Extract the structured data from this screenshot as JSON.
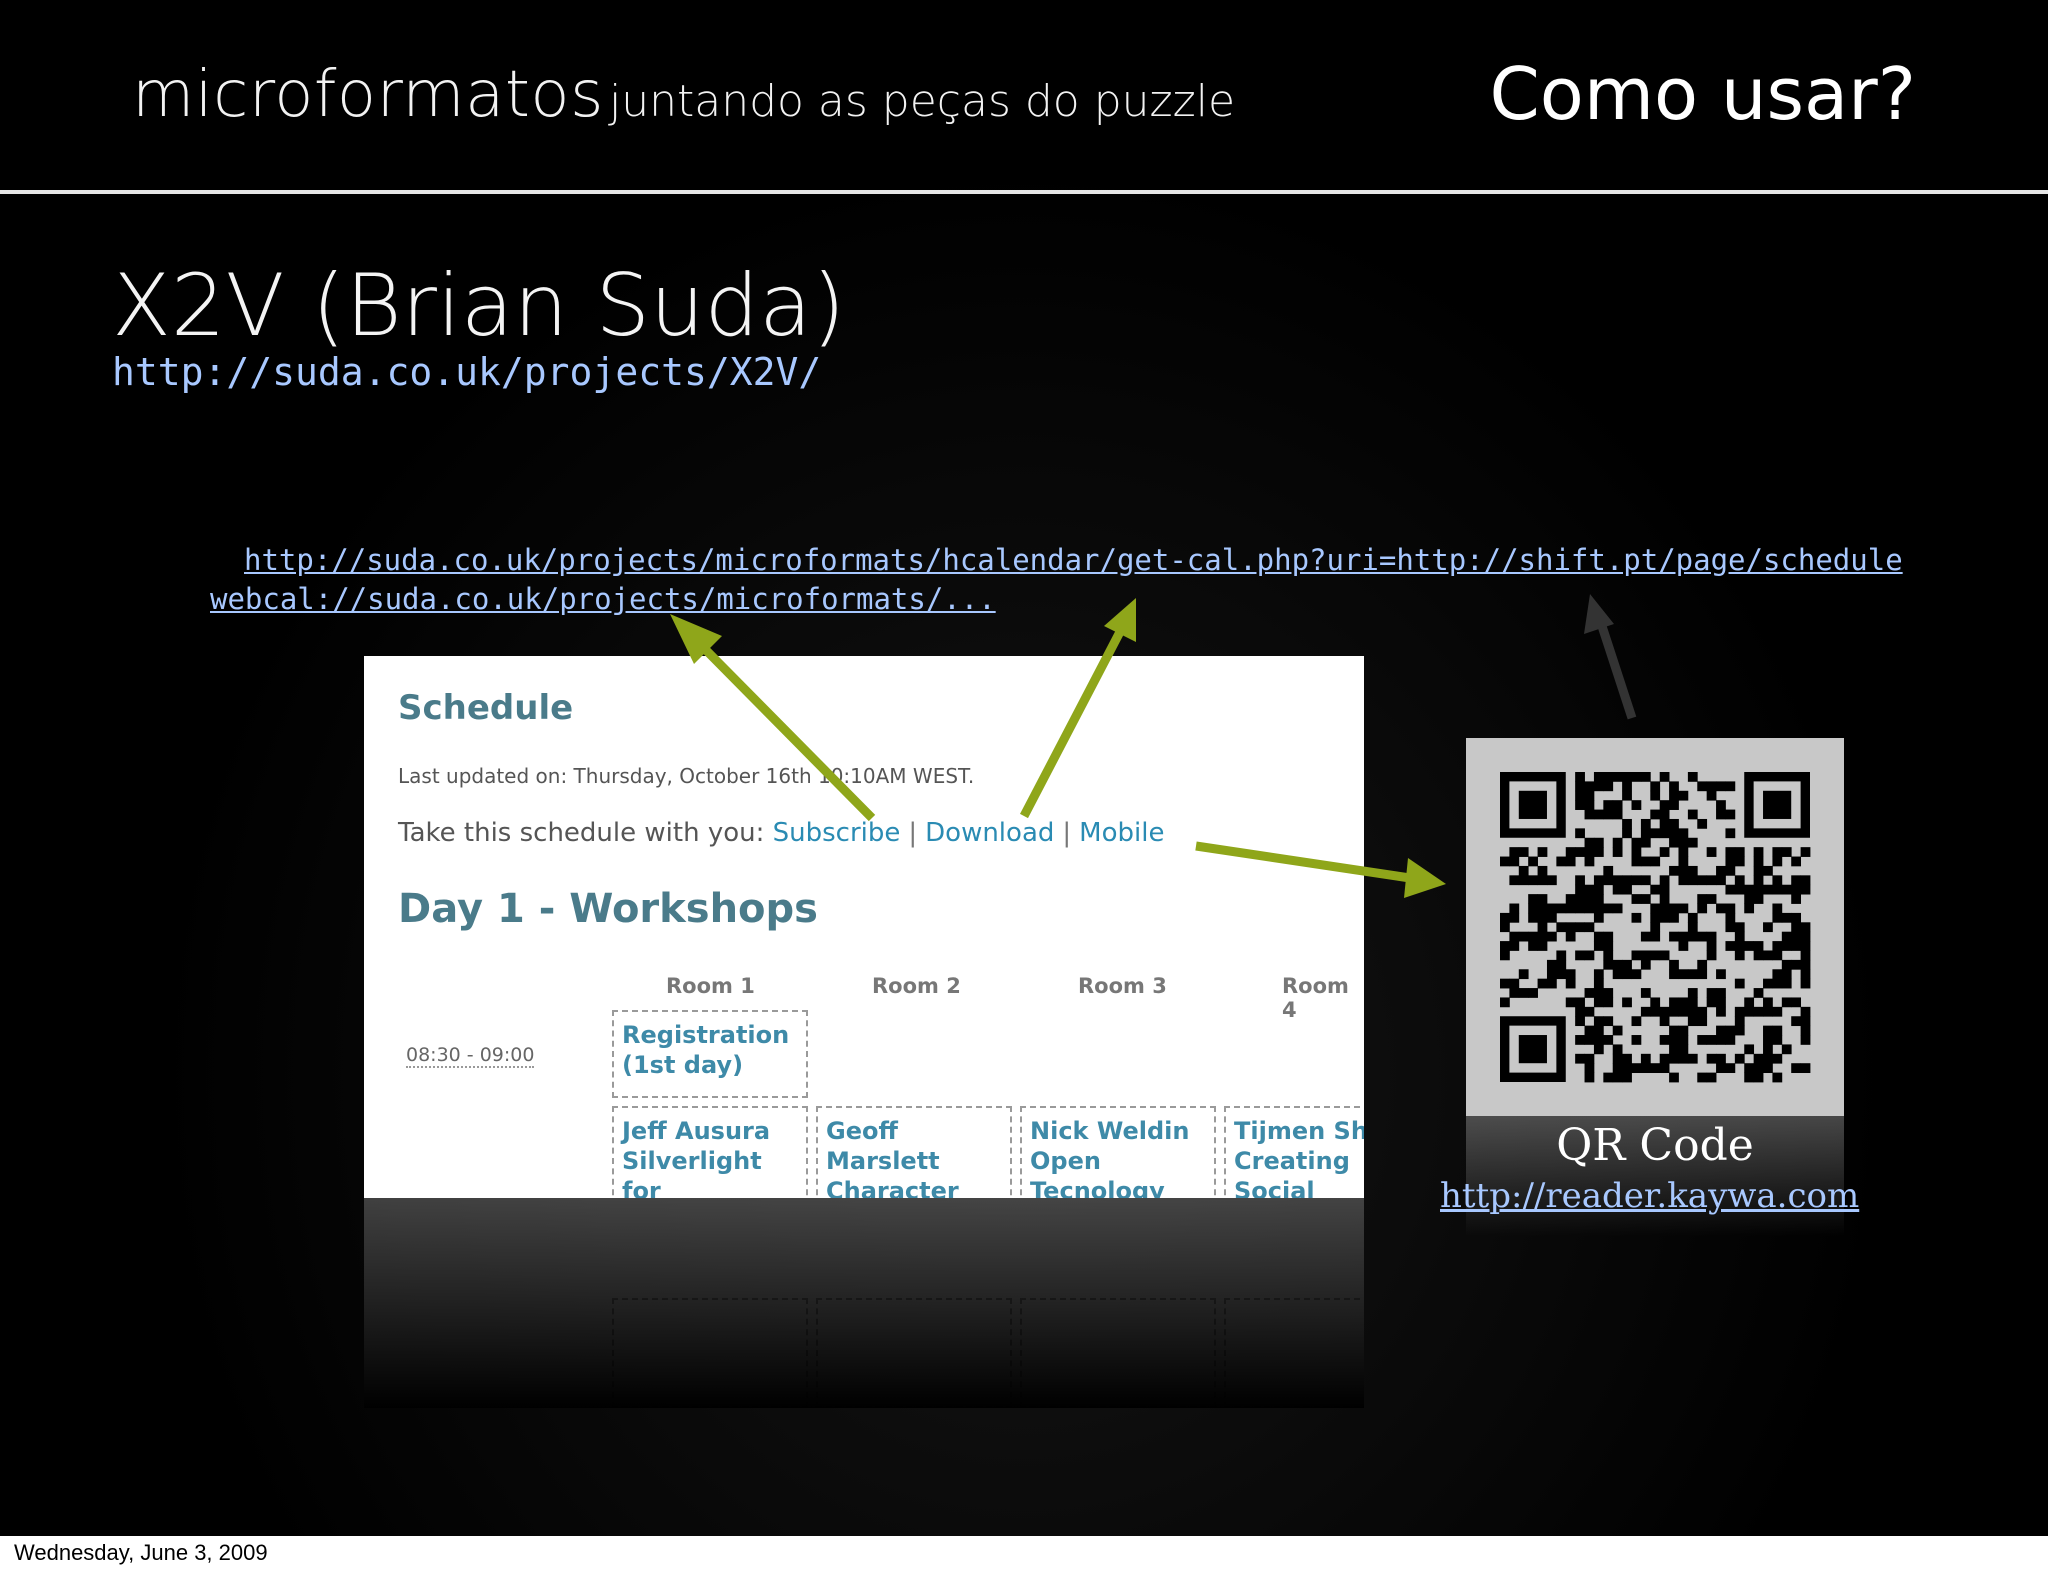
{
  "header": {
    "title_main": "microformatos",
    "title_sub": "juntando as peças do puzzle",
    "right_title": "Como usar?"
  },
  "slide": {
    "title": "X2V (Brian Suda)",
    "url": "http://suda.co.uk/projects/X2V/",
    "link_long": "http://suda.co.uk/projects/microformats/hcalendar/get-cal.php?uri=http://shift.pt/page/schedule",
    "link_webcal": "webcal://suda.co.uk/projects/microformats/...",
    "colors": {
      "background": "#000000",
      "link": "#a8c8ff",
      "arrow": "#8fa61a"
    }
  },
  "screenshot": {
    "title": "Schedule",
    "updated": "Last updated on: Thursday, October 16th 10:10AM WEST.",
    "take_label": "Take this schedule with you:",
    "links": [
      "Subscribe",
      "Download",
      "Mobile"
    ],
    "day": "Day 1 - Workshops",
    "rooms": [
      "Room 1",
      "Room 2",
      "Room 3",
      "Room 4"
    ],
    "time": "08:30 - 09:00",
    "registration": "Registration (1st day)",
    "sessions": [
      {
        "speaker": "Jeff Ausura",
        "title": "Silverlight for Designers"
      },
      {
        "speaker": "Geoff Marslett",
        "title": "Character"
      },
      {
        "speaker": "Nick Weldin",
        "title": "Open Tecnology"
      },
      {
        "speaker": "Tijmen Sh",
        "title": "Creating Social"
      }
    ]
  },
  "qr": {
    "label": "QR Code",
    "url": "http://reader.kaywa.com",
    "icon": "qr-code-icon"
  },
  "footer": {
    "date": "Wednesday, June 3, 2009"
  }
}
